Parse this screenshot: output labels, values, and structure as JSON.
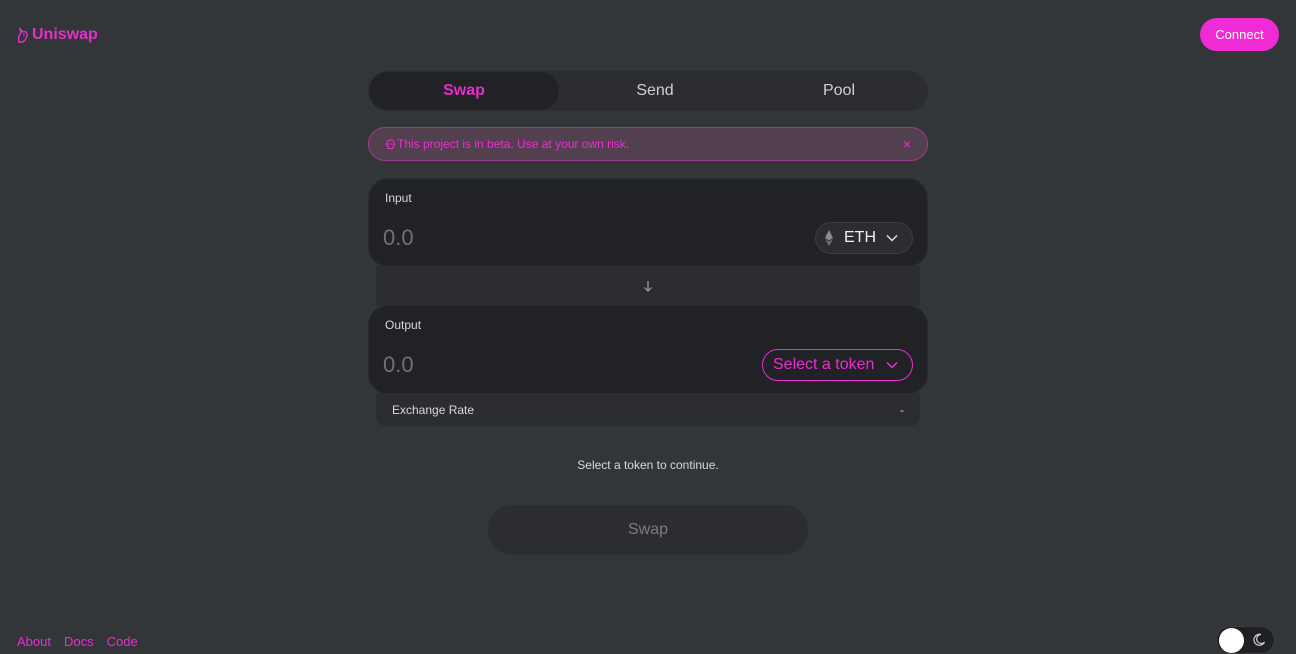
{
  "header": {
    "logo_text": "Uniswap",
    "logo_icon": "unicorn-icon",
    "connect_label": "Connect"
  },
  "tabs": [
    {
      "label": "Swap",
      "active": true
    },
    {
      "label": "Send",
      "active": false
    },
    {
      "label": "Pool",
      "active": false
    }
  ],
  "warning": {
    "icon": "skull-icon",
    "text": "This project is in beta. Use at your own risk.",
    "close_glyph": "×"
  },
  "input_panel": {
    "label": "Input",
    "placeholder": "0.0",
    "token": {
      "symbol": "ETH",
      "icon": "eth-icon"
    }
  },
  "output_panel": {
    "label": "Output",
    "placeholder": "0.0",
    "token_button_label": "Select a token"
  },
  "exchange_rate": {
    "label": "Exchange Rate",
    "value": "-"
  },
  "status_text": "Select a token to continue.",
  "swap_button_label": "Swap",
  "footer": {
    "links": [
      "About",
      "Docs",
      "Code"
    ]
  },
  "theme_toggle": {
    "mode": "dark"
  },
  "colors": {
    "accent": "#ee2bd5",
    "background": "#333639",
    "panel": "#212225"
  }
}
